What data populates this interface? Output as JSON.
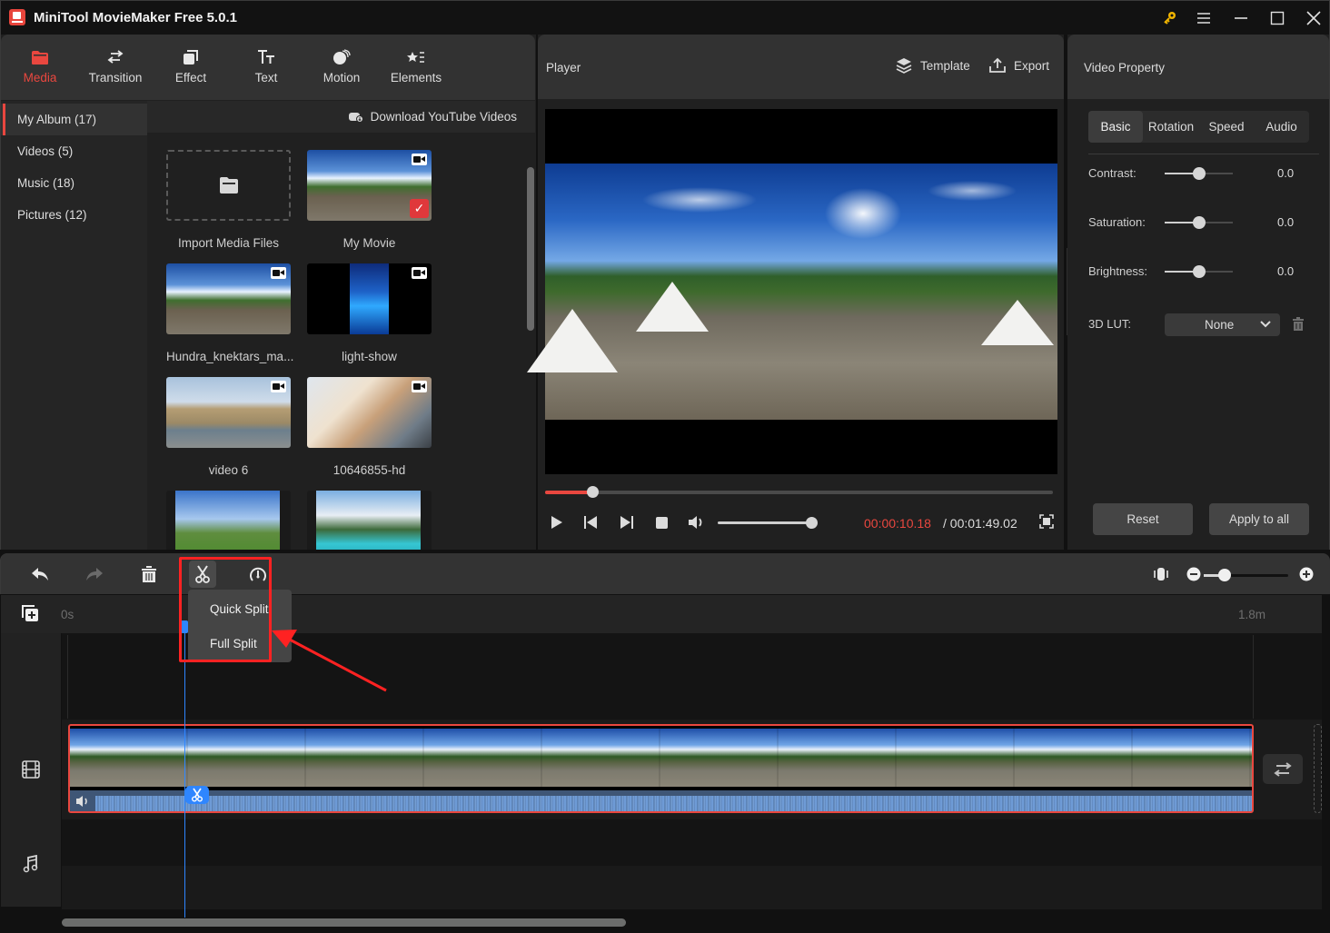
{
  "app": {
    "title": "MiniTool MovieMaker Free 5.0.1",
    "window_controls": [
      "key-icon",
      "menu-icon",
      "minimize-icon",
      "maximize-icon",
      "close-icon"
    ]
  },
  "toolbar": {
    "tools": [
      {
        "label": "Media",
        "icon": "folder-icon",
        "active": true
      },
      {
        "label": "Transition",
        "icon": "swap-arrows-icon"
      },
      {
        "label": "Effect",
        "icon": "layers-square-icon"
      },
      {
        "label": "Text",
        "icon": "text-tt-icon"
      },
      {
        "label": "Motion",
        "icon": "motion-ball-icon"
      },
      {
        "label": "Elements",
        "icon": "star-list-icon"
      }
    ]
  },
  "media": {
    "albums": [
      {
        "label": "My Album (17)",
        "active": true
      },
      {
        "label": "Videos (5)"
      },
      {
        "label": "Music (18)"
      },
      {
        "label": "Pictures (12)"
      }
    ],
    "download_link": "Download YouTube Videos",
    "items": [
      {
        "label": "Import Media Files",
        "type": "import"
      },
      {
        "label": "My Movie",
        "type": "video",
        "selected": true
      },
      {
        "label": "Hundra_knektars_ma...",
        "type": "video"
      },
      {
        "label": "light-show",
        "type": "video"
      },
      {
        "label": "video 6",
        "type": "video"
      },
      {
        "label": "10646855-hd",
        "type": "video"
      },
      {
        "label": "",
        "type": "image"
      },
      {
        "label": "",
        "type": "image"
      }
    ]
  },
  "player": {
    "title": "Player",
    "template_label": "Template",
    "export_label": "Export",
    "progress_fraction": 0.093,
    "volume_fraction": 1.0,
    "current_time": "00:00:10.18",
    "total_time": "/ 00:01:49.02",
    "accent": "#e9473f"
  },
  "property": {
    "title": "Video Property",
    "tabs": [
      {
        "label": "Basic",
        "active": true
      },
      {
        "label": "Rotation"
      },
      {
        "label": "Speed"
      },
      {
        "label": "Audio"
      }
    ],
    "rows": [
      {
        "label": "Contrast:",
        "value": "0.0",
        "fraction": 0.5
      },
      {
        "label": "Saturation:",
        "value": "0.0",
        "fraction": 0.5
      },
      {
        "label": "Brightness:",
        "value": "0.0",
        "fraction": 0.5
      }
    ],
    "lut_label": "3D LUT:",
    "lut_value": "None",
    "reset_label": "Reset",
    "apply_label": "Apply to all"
  },
  "timeline": {
    "ruler_start": "0s",
    "ruler_end": "1.8m",
    "zoom_fraction": 0.25,
    "split_menu": {
      "items": [
        "Quick Split",
        "Full Split"
      ]
    }
  }
}
